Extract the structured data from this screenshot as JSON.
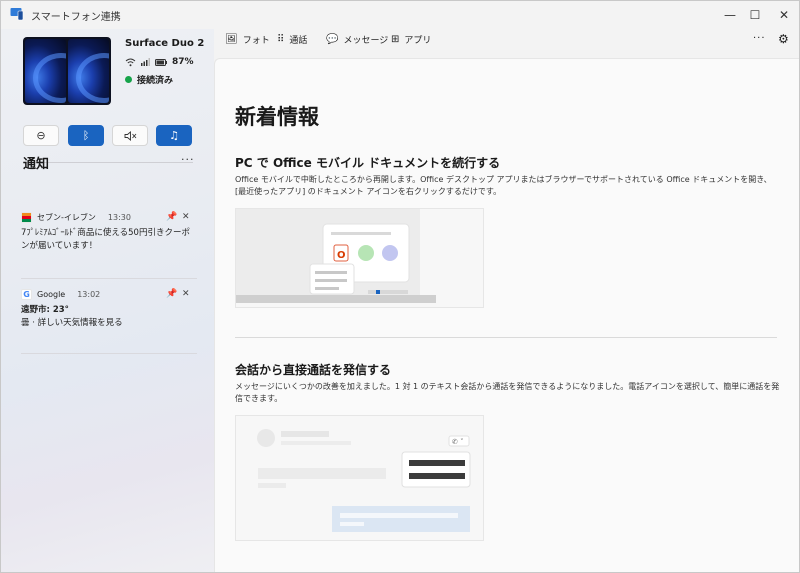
{
  "window": {
    "title": "スマートフォン連携",
    "controls": {
      "minimize": "—",
      "maximize": "☐",
      "close": "✕"
    }
  },
  "device": {
    "name": "Surface Duo 2",
    "battery": "87%",
    "connection_status": "接続済み",
    "status_color": "#16a34a"
  },
  "quick_actions": [
    {
      "icon": "do-not-disturb-icon",
      "glyph": "⊖",
      "active": false
    },
    {
      "icon": "bluetooth-icon",
      "glyph": "ᛒ",
      "active": true
    },
    {
      "icon": "mute-icon",
      "glyph": "🔇",
      "active": false
    },
    {
      "icon": "music-icon",
      "glyph": "♫",
      "active": true
    }
  ],
  "notifications": {
    "title": "通知",
    "more": "···",
    "items": [
      {
        "app": "セブン-イレブン",
        "time": "13:30",
        "line1": "7ﾌﾟﾚﾐｱﾑｺﾞｰﾙﾄﾞ商品に使える50円引きクーポ",
        "line2": "ンが届いています！"
      },
      {
        "app": "Google",
        "time": "13:02",
        "line1": "遠野市: 23°",
        "line2": "曇 · 詳しい天気情報を見る"
      }
    ]
  },
  "nav": {
    "photos": "フォト",
    "calls": "通話",
    "messages": "メッセージ",
    "apps": "アプリ",
    "more": "···",
    "accent": "#1a64c0"
  },
  "main": {
    "heading": "新着情報",
    "sections": [
      {
        "title": "PC で Office モバイル ドキュメントを続行する",
        "desc": "Office モバイルで中断したところから再開します。Office デスクトップ アプリまたはブラウザーでサポートされている Office ドキュメントを開き、[最近使ったアプリ] のドキュメント アイコンを右クリックするだけです。"
      },
      {
        "title": "会話から直接通話を発信する",
        "desc": "メッセージにいくつかの改善を加えました。1 対 1 のテキスト会話から通話を発信できるようになりました。電話アイコンを選択して、簡単に通話を発信できます。"
      }
    ]
  }
}
